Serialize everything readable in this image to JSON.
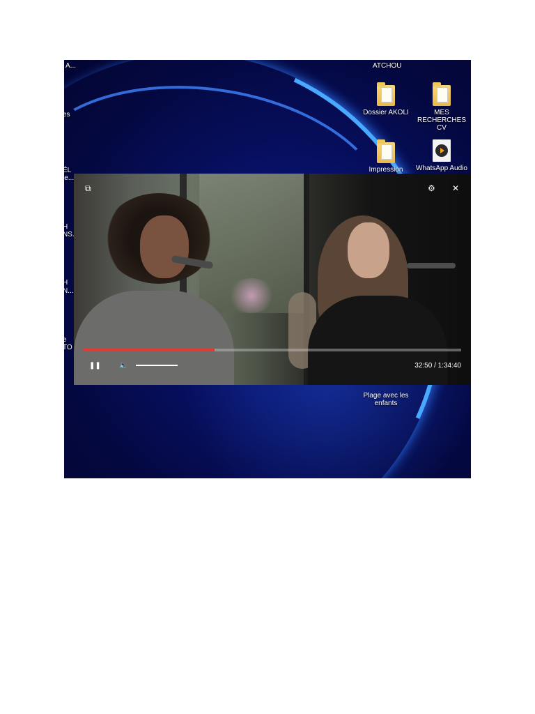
{
  "desktop": {
    "left_edge_labels": [
      "A...",
      "es",
      "ÉL",
      "le...",
      "H",
      "NS...",
      "H",
      "N...",
      "e",
      "TO"
    ],
    "user_label": "ATCHOU",
    "icons": [
      {
        "label": "Dossier AKOLI",
        "icon": "folder-icon"
      },
      {
        "label": "MES RECHERCHES CV",
        "icon": "folder-icon"
      },
      {
        "label": "Impression",
        "icon": "folder-icon"
      },
      {
        "label": "WhatsApp Audio",
        "icon": "media-file-icon"
      },
      {
        "label": "Plage avec les enfants",
        "icon": "image-file-icon"
      }
    ]
  },
  "player": {
    "popout_icon": "⧉",
    "settings_icon": "⚙",
    "close_icon": "✕",
    "play_pause_icon": "❚❚",
    "volume_icon": "🔈",
    "time_display": "32:50 / 1:34:40",
    "progress_fraction": 0.347,
    "progress_color": "#e53935"
  }
}
